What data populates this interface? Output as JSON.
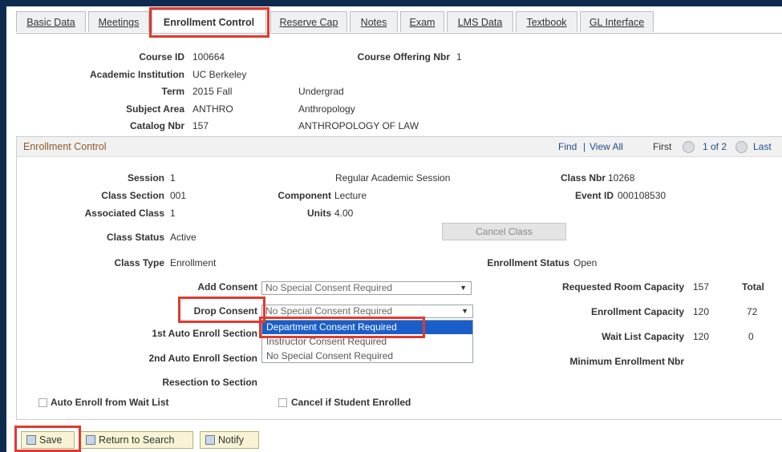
{
  "tabs": [
    {
      "label": "Basic Data"
    },
    {
      "label": "Meetings"
    },
    {
      "label": "Enrollment Control"
    },
    {
      "label": "Reserve Cap"
    },
    {
      "label": "Notes"
    },
    {
      "label": "Exam"
    },
    {
      "label": "LMS Data"
    },
    {
      "label": "Textbook"
    },
    {
      "label": "GL Interface"
    }
  ],
  "header": {
    "course_id_label": "Course ID",
    "course_id": "100664",
    "offering_label": "Course Offering Nbr",
    "offering": "1",
    "institution_label": "Academic Institution",
    "institution": "UC Berkeley",
    "term_label": "Term",
    "term": "2015 Fall",
    "career": "Undergrad",
    "subject_label": "Subject Area",
    "subject": "ANTHRO",
    "subject_desc": "Anthropology",
    "catalog_label": "Catalog Nbr",
    "catalog": "157",
    "catalog_desc": "ANTHROPOLOGY OF LAW"
  },
  "panel": {
    "title": "Enrollment Control",
    "find": "Find",
    "sep": "|",
    "view_all": "View All",
    "first": "First",
    "pager": "1 of 2",
    "last": "Last"
  },
  "fields": {
    "session_label": "Session",
    "session": "1",
    "session_desc": "Regular Academic Session",
    "class_nbr_label": "Class Nbr",
    "class_nbr": "10268",
    "section_label": "Class Section",
    "section": "001",
    "component_label": "Component",
    "component": "Lecture",
    "event_label": "Event ID",
    "event": "000108530",
    "assoc_label": "Associated Class",
    "assoc": "1",
    "units_label": "Units",
    "units": "4.00",
    "status_label": "Class Status",
    "status": "Active",
    "cancel_class": "Cancel Class",
    "type_label": "Class Type",
    "type": "Enrollment",
    "enroll_status_label": "Enrollment Status",
    "enroll_status": "Open",
    "add_consent_label": "Add Consent",
    "add_consent": "No Special Consent Required",
    "drop_consent_label": "Drop Consent",
    "drop_consent": "No Special Consent Required",
    "auto1_label": "1st Auto Enroll Section",
    "auto2_label": "2nd Auto Enroll Section",
    "resection_label": "Resection to Section",
    "room_cap_label": "Requested Room Capacity",
    "room_cap": "157",
    "total_label": "Total",
    "enroll_cap_label": "Enrollment Capacity",
    "enroll_cap": "120",
    "enroll_total": "72",
    "wait_cap_label": "Wait List Capacity",
    "wait_cap": "120",
    "wait_total": "0",
    "min_enroll_label": "Minimum Enrollment Nbr",
    "auto_waitlist_label": "Auto Enroll from Wait List",
    "cancel_if_label": "Cancel if Student Enrolled"
  },
  "dropdown_options": [
    {
      "label": "Department Consent Required",
      "selected": true
    },
    {
      "label": "Instructor Consent Required",
      "selected": false
    },
    {
      "label": "No Special Consent Required",
      "selected": false
    }
  ],
  "footer": {
    "save": "Save",
    "return": "Return to Search",
    "notify": "Notify"
  },
  "colors": {
    "highlight": "#e03a2f",
    "selected_option": "#1a5fc9",
    "panel_title": "#8b5a2b",
    "frame": "#0e2a4e"
  },
  "icons": {
    "save": "save-icon",
    "return": "return-search-icon",
    "notify": "notify-icon",
    "prev": "previous-icon",
    "next": "next-icon"
  }
}
